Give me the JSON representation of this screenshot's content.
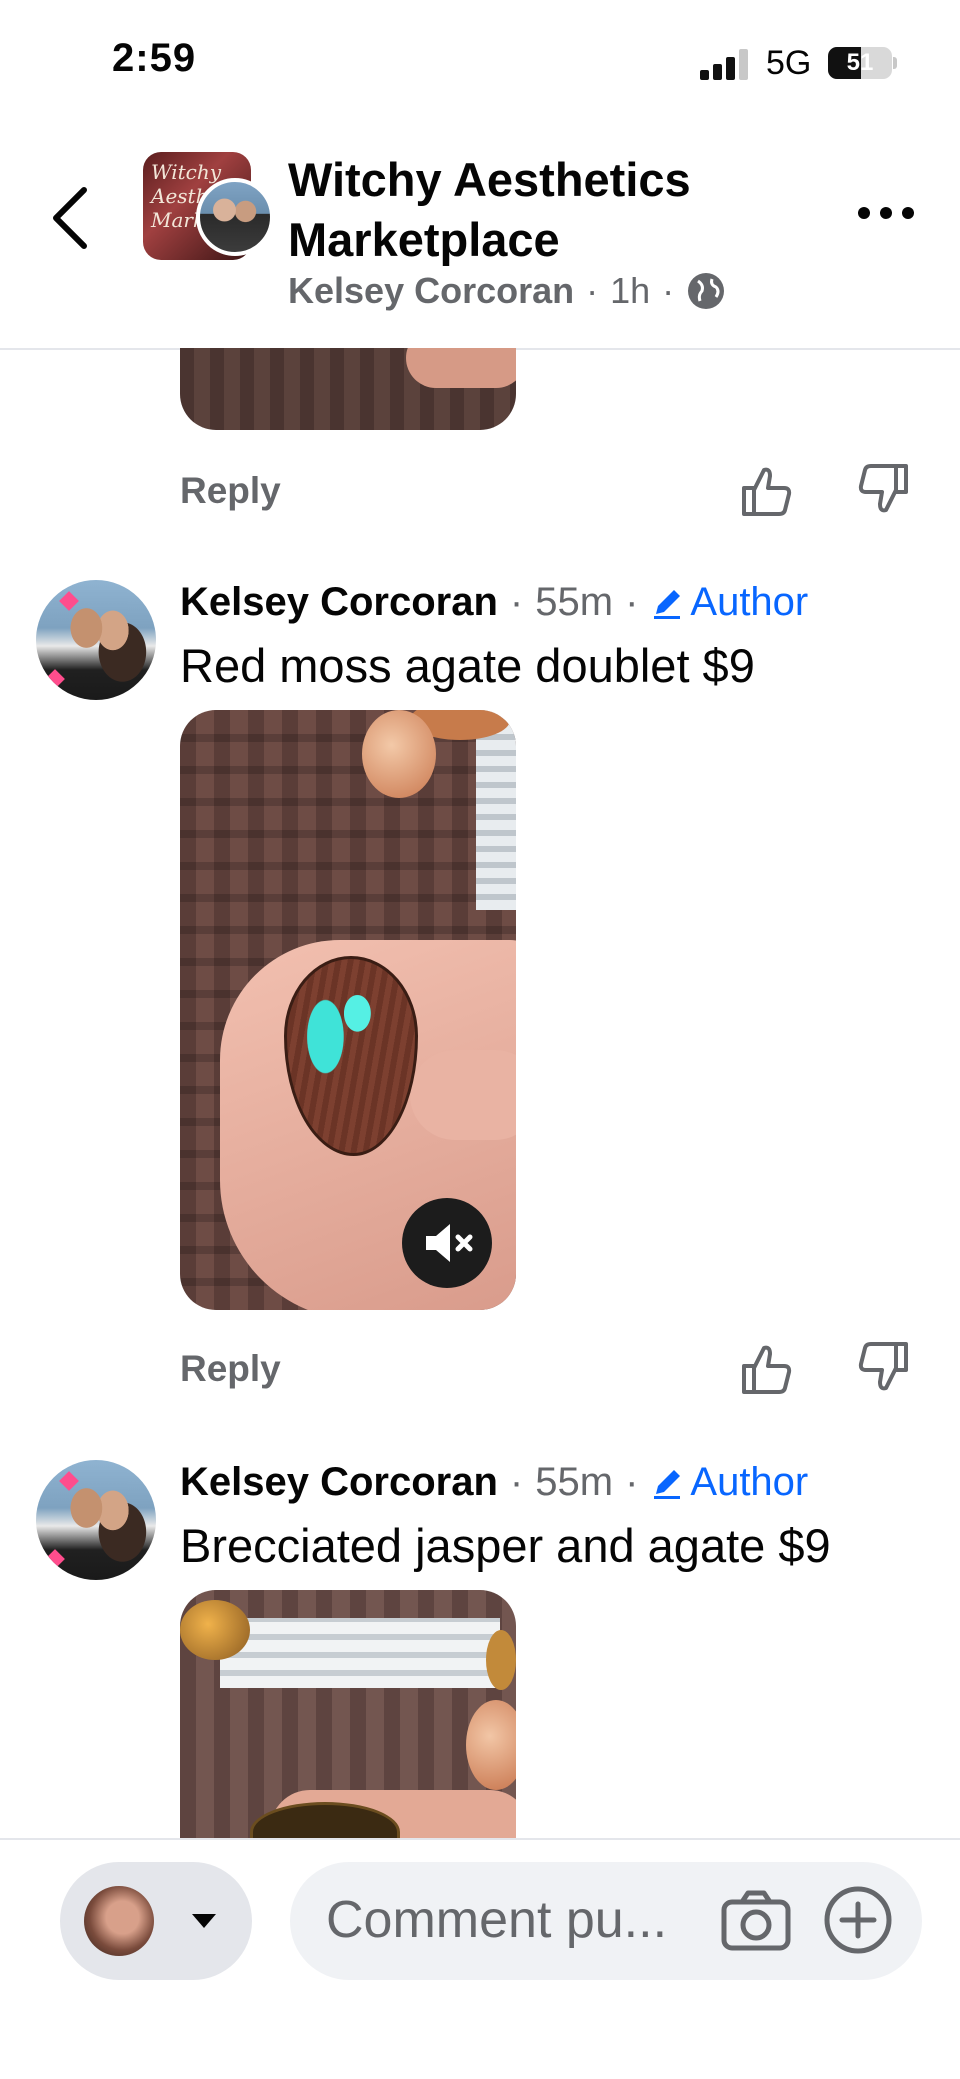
{
  "status_bar": {
    "time": "2:59",
    "network": "5G",
    "battery": "51",
    "battery_level": 0.51
  },
  "header": {
    "title": "Witchy Aesthetics Marketplace",
    "avatar_text": "Witchy Aesth Mark",
    "author": "Kelsey Corcoran",
    "time": "1h",
    "separator": "·",
    "privacy_icon": "globe-icon"
  },
  "thread": {
    "previous": {
      "reply_label": "Reply"
    },
    "comments": [
      {
        "author": "Kelsey Corcoran",
        "time": "55m",
        "badge": "Author",
        "separator": "·",
        "text": "Red moss agate doublet $9",
        "reply_label": "Reply",
        "media": "video",
        "muted": true
      },
      {
        "author": "Kelsey Corcoran",
        "time": "55m",
        "badge": "Author",
        "separator": "·",
        "text": "Brecciated jasper and agate $9",
        "media": "video"
      }
    ]
  },
  "composer": {
    "placeholder": "Comment pu..."
  },
  "colors": {
    "accent": "#0866ff",
    "secondary_text": "#65676b",
    "divider": "#e4e6eb",
    "input_bg": "#f0f2f5"
  }
}
